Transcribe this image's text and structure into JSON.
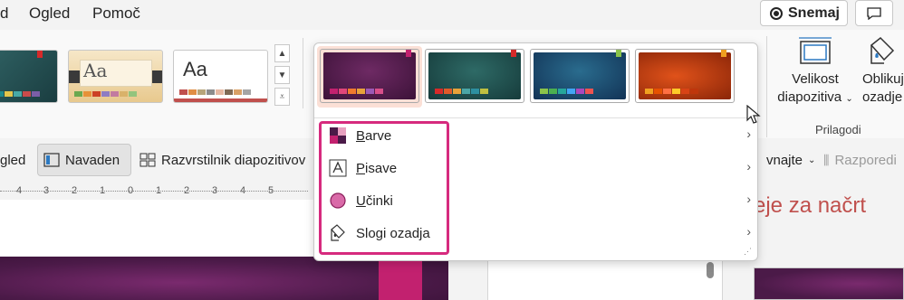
{
  "menubar": {
    "items": [
      "d",
      "Ogled",
      "Pomoč"
    ],
    "record_label": "Snemaj"
  },
  "ribbon": {
    "themes": [
      {
        "label": "",
        "colors": [
          "#2e5f61",
          "#1d8a8e",
          "#e4c54b",
          "#48a9a6",
          "#c94b4b",
          "#7b5ea7"
        ]
      },
      {
        "label": "Aa",
        "colors": [
          "#d9b26a",
          "#6aa84f",
          "#e69138",
          "#cc4125",
          "#8e7cc3",
          "#c27ba0"
        ]
      },
      {
        "label": "Aa",
        "colors": [
          "#c0504d",
          "#e08e45",
          "#b7a57a",
          "#8c8c8c",
          "#e6b8a2",
          "#7f6a55"
        ]
      }
    ],
    "variants": [
      {
        "name": "Purple",
        "bg": "#4b1a48",
        "tag": "#c2216f",
        "colors": [
          "#c2216f",
          "#e0467a",
          "#f07a2e",
          "#e8a23a",
          "#9b59b6",
          "#d94f8a"
        ]
      },
      {
        "name": "Teal",
        "bg": "#1e4a4a",
        "tag": "#d62a2a",
        "colors": [
          "#d62a2a",
          "#e05a2a",
          "#e8a23a",
          "#4aa6a6",
          "#2d8fa0",
          "#c0c040"
        ]
      },
      {
        "name": "Blue",
        "bg": "#1b3f6b",
        "tag": "#8bc34a",
        "colors": [
          "#8bc34a",
          "#4caf50",
          "#26a69a",
          "#42a5f5",
          "#ab47bc",
          "#ef5350"
        ]
      },
      {
        "name": "Red",
        "bg": "#b3360f",
        "tag": "#f0a020",
        "colors": [
          "#f0a020",
          "#e65100",
          "#ff7043",
          "#ffca28",
          "#d84315",
          "#bf360c"
        ]
      }
    ],
    "dropdown": [
      {
        "label_ul": "B",
        "label_rest": "arve",
        "icon": "colors-icon"
      },
      {
        "label_ul": "P",
        "label_rest": "isave",
        "icon": "fonts-icon"
      },
      {
        "label_ul": "U",
        "label_rest": "činki",
        "icon": "effects-icon"
      },
      {
        "label_ul": "",
        "label_rest": "Slogi ozadja",
        "icon": "background-styles-icon"
      }
    ],
    "velikost_label_1": "Velikost",
    "velikost_label_2": "diapozitiva",
    "oblikuj_label_1": "Oblikuj",
    "oblikuj_label_2": "ozadje",
    "group_label": "Prilagodi"
  },
  "viewbar": {
    "left_partial": "gled",
    "navaden": "Navaden",
    "razvrstilnik": "Razvrstilnik diapozitivov",
    "poravnajte": "vnajte",
    "razporedi": "Razporedi"
  },
  "ruler": {
    "ticks": [
      "4",
      "3",
      "2",
      "1",
      "0",
      "1",
      "2",
      "3",
      "4",
      "5"
    ]
  },
  "slide": {
    "title_partial": "eje za načrt"
  },
  "colors": {
    "highlight": "#d62a7e",
    "accent_text": "#c0504d"
  }
}
